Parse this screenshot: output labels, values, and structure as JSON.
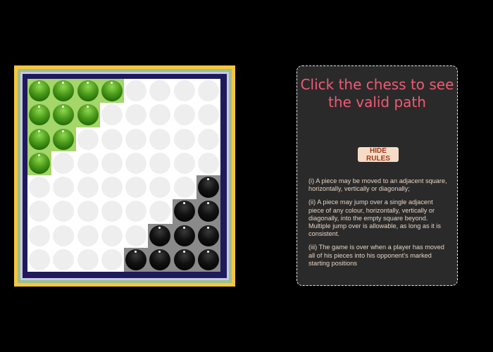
{
  "game": {
    "board_size": 8,
    "pieces": [
      {
        "row": 0,
        "col": 0,
        "color": "green"
      },
      {
        "row": 0,
        "col": 1,
        "color": "green"
      },
      {
        "row": 0,
        "col": 2,
        "color": "green"
      },
      {
        "row": 0,
        "col": 3,
        "color": "green"
      },
      {
        "row": 1,
        "col": 0,
        "color": "green"
      },
      {
        "row": 1,
        "col": 1,
        "color": "green"
      },
      {
        "row": 1,
        "col": 2,
        "color": "green"
      },
      {
        "row": 2,
        "col": 0,
        "color": "green"
      },
      {
        "row": 2,
        "col": 1,
        "color": "green"
      },
      {
        "row": 3,
        "col": 0,
        "color": "green"
      },
      {
        "row": 4,
        "col": 7,
        "color": "black"
      },
      {
        "row": 5,
        "col": 6,
        "color": "black"
      },
      {
        "row": 5,
        "col": 7,
        "color": "black"
      },
      {
        "row": 6,
        "col": 5,
        "color": "black"
      },
      {
        "row": 6,
        "col": 6,
        "color": "black"
      },
      {
        "row": 6,
        "col": 7,
        "color": "black"
      },
      {
        "row": 7,
        "col": 4,
        "color": "black"
      },
      {
        "row": 7,
        "col": 5,
        "color": "black"
      },
      {
        "row": 7,
        "col": 6,
        "color": "black"
      },
      {
        "row": 7,
        "col": 7,
        "color": "black"
      }
    ],
    "colors": {
      "green_zone": "#a4d66a",
      "black_zone": "#8a8a8a",
      "frame_outer": "#f4c63f",
      "frame_inner": "#1e1a5c"
    }
  },
  "panel": {
    "title": "Click the chess to see the valid path",
    "rules_button": "HIDE RULES",
    "rules": [
      "(i) A piece may be moved to an adjacent square, horizontally, vertically or diagonally;",
      "(ii) A piece may jump over a single adjacent piece of any colour, horizontally, vertically or diagonally, into the empty square beyond. Multiple jump over is allowable, as long as it is consistent.",
      "(iii) The game is over when a player has moved all of his pieces into his opponent's marked starting positions"
    ],
    "accent_color": "#f25a73"
  }
}
